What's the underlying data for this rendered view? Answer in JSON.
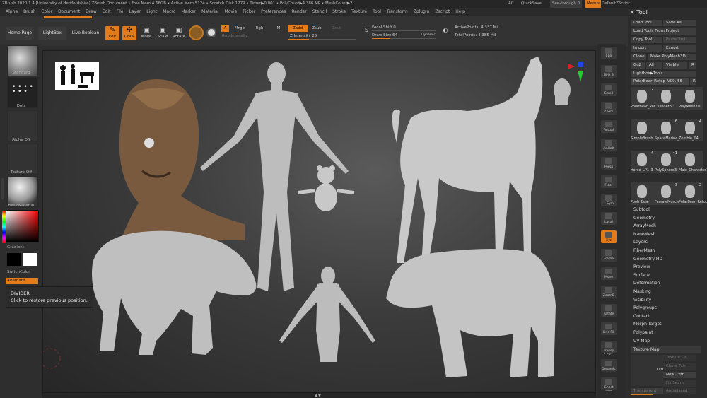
{
  "titlebar": {
    "title": "ZBrush 2020.1.4 [University of Hertfordshire]   ZBrush Document   • Free Mem 4.66GB • Active Mem 5124 • Scratch Disk 1279 • Timer▶0.001 • PolyCount▶4.386 MP • MeshCount▶2",
    "ac": "AC",
    "quicksave": "QuickSave",
    "seethrough": "See-through",
    "seethrough_val": "0",
    "menus": "Menus",
    "defaultzscript": "DefaultZScript"
  },
  "menubar": [
    "Alpha",
    "Brush",
    "Color",
    "Document",
    "Draw",
    "Edit",
    "File",
    "Layer",
    "Light",
    "Macro",
    "Marker",
    "Material",
    "Movie",
    "Picker",
    "Preferences",
    "Render",
    "Stencil",
    "Stroke",
    "Texture",
    "Tool",
    "Transform",
    "Zplugin",
    "Zscript",
    "Help"
  ],
  "toolbar": {
    "home_page": "Home Page",
    "lightbox": "LightBox",
    "live_boolean": "Live Boolean",
    "edit": "Edit",
    "draw": "Draw",
    "move": "Move",
    "scale": "Scale",
    "rotate": "Rotate",
    "a": "A",
    "mrgb": "Mrgb",
    "rgb": "Rgb",
    "m": "M",
    "rgb_intensity": "Rgb Intensity",
    "zadd": "Zadd",
    "zsub": "Zsub",
    "zcut": "Zcut",
    "z_intensity": "Z Intensity 25",
    "focal_shift": "Focal Shift 0",
    "draw_size": "Draw Size 64",
    "dynamic": "Dynamic",
    "active_points": "ActivePoints: 4.337 Mil",
    "total_points": "TotalPoints: 4.385 Mil"
  },
  "leftpanel": {
    "standard": "Standard",
    "dots": "Dots",
    "alpha_off": "Alpha Off",
    "texture_off": "Texture Off",
    "basic_material": "BasicMaterial",
    "gradient": "Gradient",
    "switch_color": "SwitchColor",
    "alternate": "Alternate"
  },
  "tooltip": {
    "title": "DIVIDER",
    "body": "Click to restore previous position."
  },
  "rightshelf": [
    "BPR",
    "SPix 3",
    "Scroll",
    "Zoom",
    "Actual",
    "AAHalf",
    "Persp",
    "Floor",
    "L.Sym",
    "Local",
    "Xyz",
    "Frame",
    "Move",
    "ZoomD",
    "Rotate",
    "Line Fill PolyF",
    "Transp",
    "Dynamic Solo",
    "Ghost"
  ],
  "toolpanel": {
    "title": "Tool",
    "load_tool": "Load Tool",
    "save_as": "Save As",
    "load_project": "Load Tools From Project",
    "copy_tool": "Copy Tool",
    "paste_tool": "Paste Tool",
    "import": "Import",
    "export": "Export",
    "clone": "Clone",
    "make_polymesh": "Make PolyMesh3D",
    "goz": "GoZ",
    "all": "All",
    "visible": "Visible",
    "r": "R",
    "lightbox_tools": "Lightbox▶Tools",
    "current_tool": "PolarBear_Retop_V09. 55",
    "r2": "R",
    "thumbs": [
      {
        "label": "PolarBear_Retop",
        "badge": "2"
      },
      {
        "label": "Cylinder3D",
        "badge": ""
      },
      {
        "label": "PolyMesh3D",
        "badge": ""
      },
      {
        "label": "SimpleBrush",
        "badge": ""
      },
      {
        "label": "SpaceMarine_An",
        "badge": "6"
      },
      {
        "label": "Zombie_04",
        "badge": "4"
      },
      {
        "label": "Horse_LP1_3",
        "badge": "4"
      },
      {
        "label": "PolySphere3_2",
        "badge": "41"
      },
      {
        "label": "Male_Character1",
        "badge": ""
      },
      {
        "label": "Pooh_Bear",
        "badge": ""
      },
      {
        "label": "FemaleMuscleFo",
        "badge": "3"
      },
      {
        "label": "PolarBear_Retop",
        "badge": "2"
      }
    ],
    "subpalettes": [
      "Subtool",
      "Geometry",
      "ArrayMesh",
      "NanoMesh",
      "Layers",
      "FiberMesh",
      "Geometry HD",
      "Preview",
      "Surface",
      "Deformation",
      "Masking",
      "Visibility",
      "Polygroups",
      "Contact",
      "Morph Target",
      "Polypaint",
      "UV Map"
    ],
    "texture_map": "Texture Map",
    "texture_on": "Texture On",
    "clone_txtr": "Clone Txtr",
    "new_txtr": "New Txtr",
    "fix_seam": "Fix Seam",
    "transparent": "Transparent",
    "antialiased": "Antialiased",
    "txtr": "Txtr"
  },
  "colors": {
    "accent": "#e47b19",
    "bg": "#2e2e2e",
    "canvas": "#3c3c3c"
  }
}
